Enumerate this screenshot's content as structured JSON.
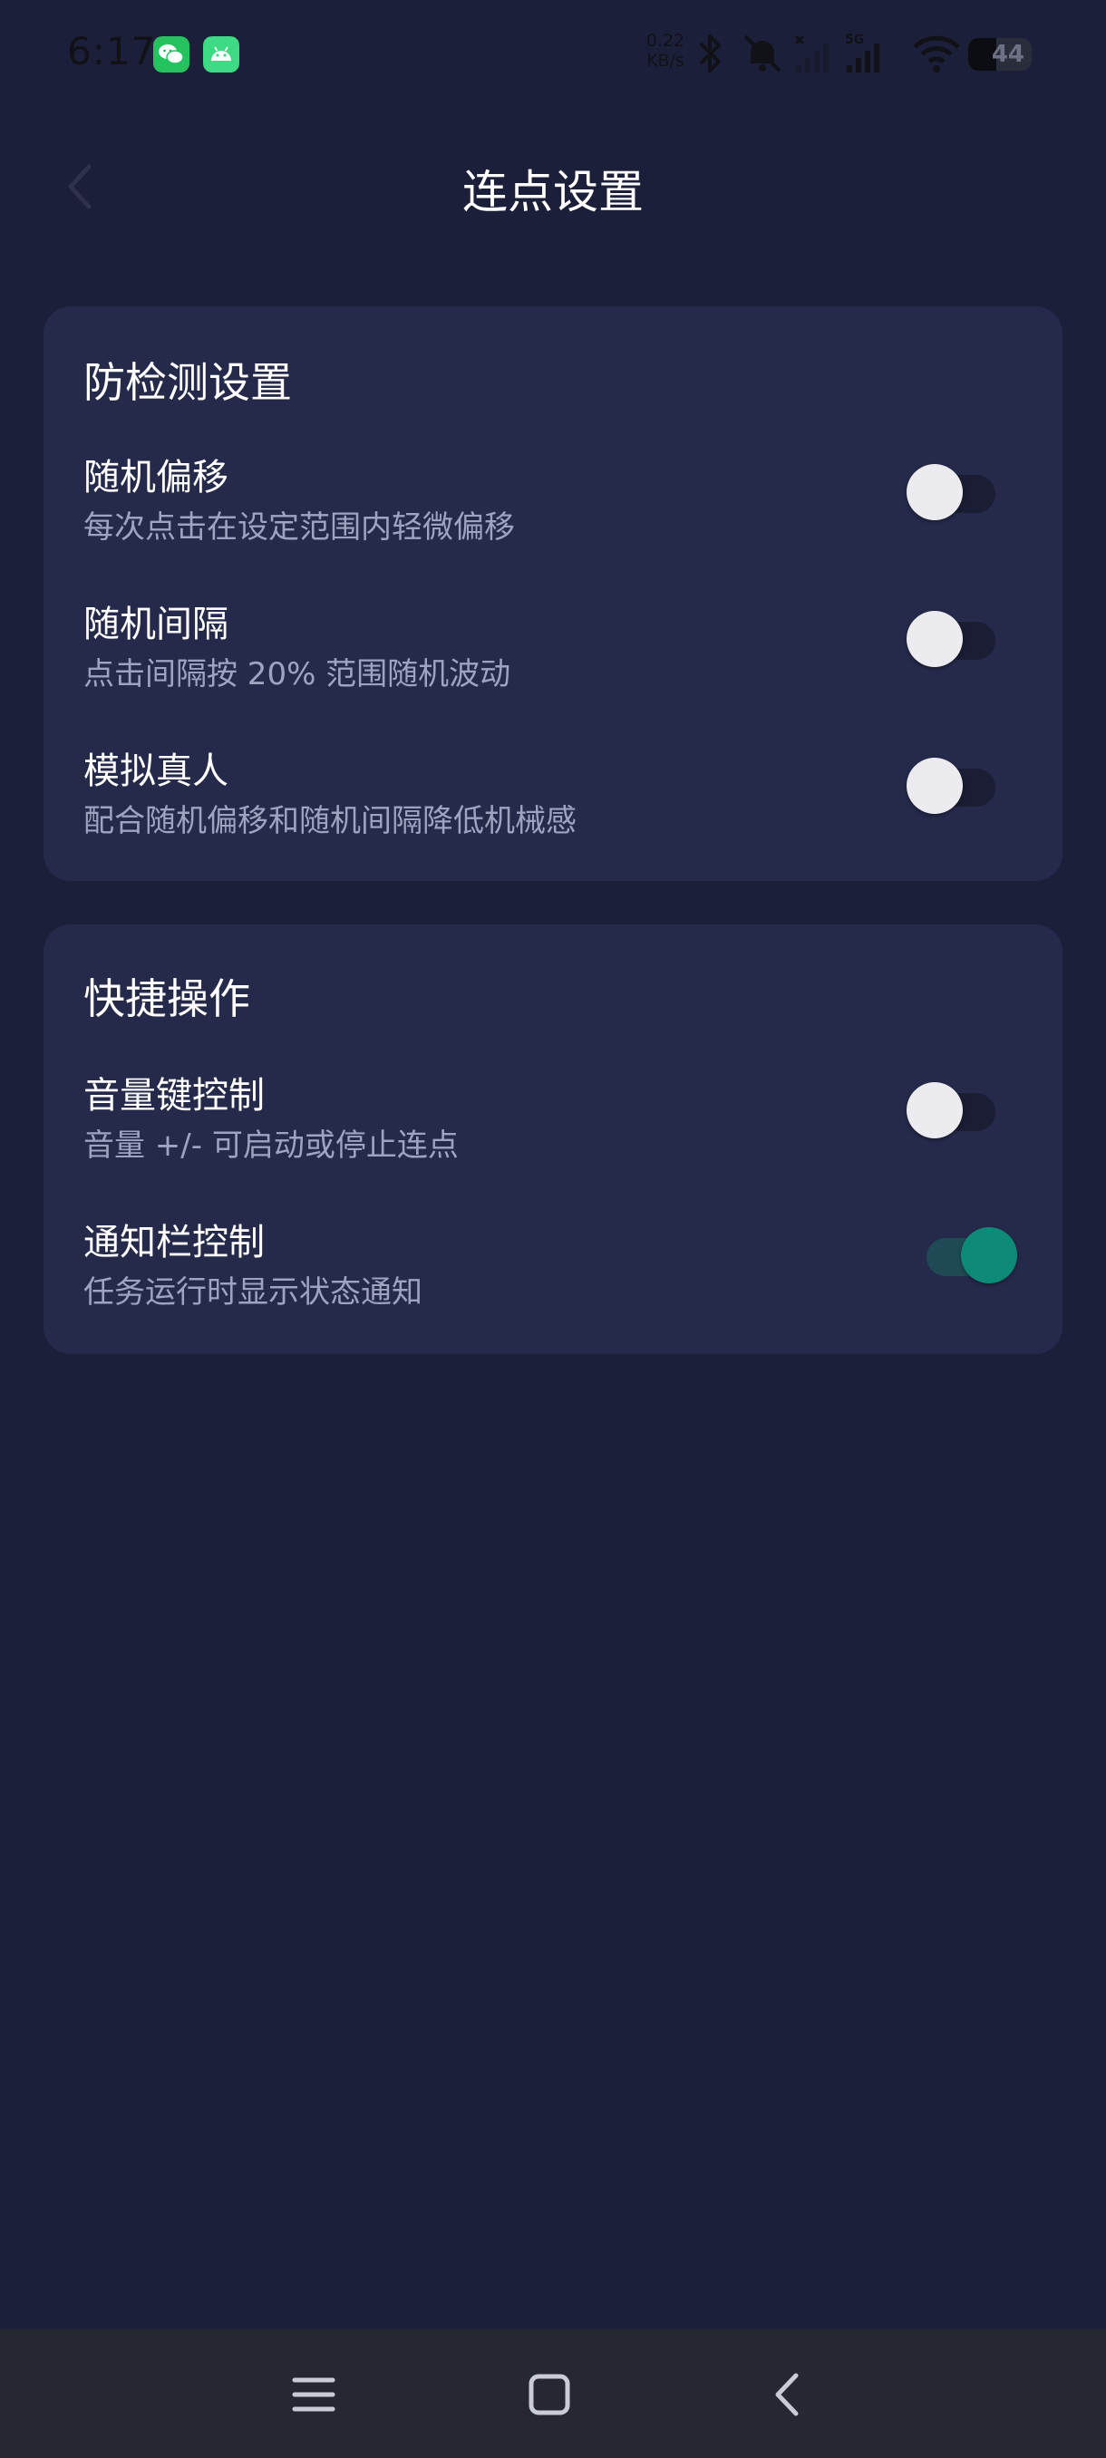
{
  "status_bar": {
    "time": "6:17",
    "net_speed_value": "0.22",
    "net_speed_unit": "KB/s",
    "network_type": "5G",
    "battery": "44",
    "battery_level": 0.44
  },
  "header": {
    "title": "连点设置"
  },
  "sections": [
    {
      "title": "防检测设置",
      "items": [
        {
          "title": "随机偏移",
          "description": "每次点击在设定范围内轻微偏移",
          "enabled": false
        },
        {
          "title": "随机间隔",
          "description": "点击间隔按 20% 范围随机波动",
          "enabled": false
        },
        {
          "title": "模拟真人",
          "description": "配合随机偏移和随机间隔降低机械感",
          "enabled": false
        }
      ]
    },
    {
      "title": "快捷操作",
      "items": [
        {
          "title": "音量键控制",
          "description": "音量 +/- 可启动或停止连点",
          "enabled": false
        },
        {
          "title": "通知栏控制",
          "description": "任务运行时显示状态通知",
          "enabled": true
        }
      ]
    }
  ],
  "colors": {
    "background": "#1c1f3a",
    "card": "#252a4b",
    "accent": "#0d8a78",
    "secondary_text": "#9ea3bf"
  },
  "icons": {
    "back": "chevron-left-icon",
    "nav_menu": "menu-icon",
    "nav_home": "home-icon",
    "nav_back": "back-icon"
  }
}
